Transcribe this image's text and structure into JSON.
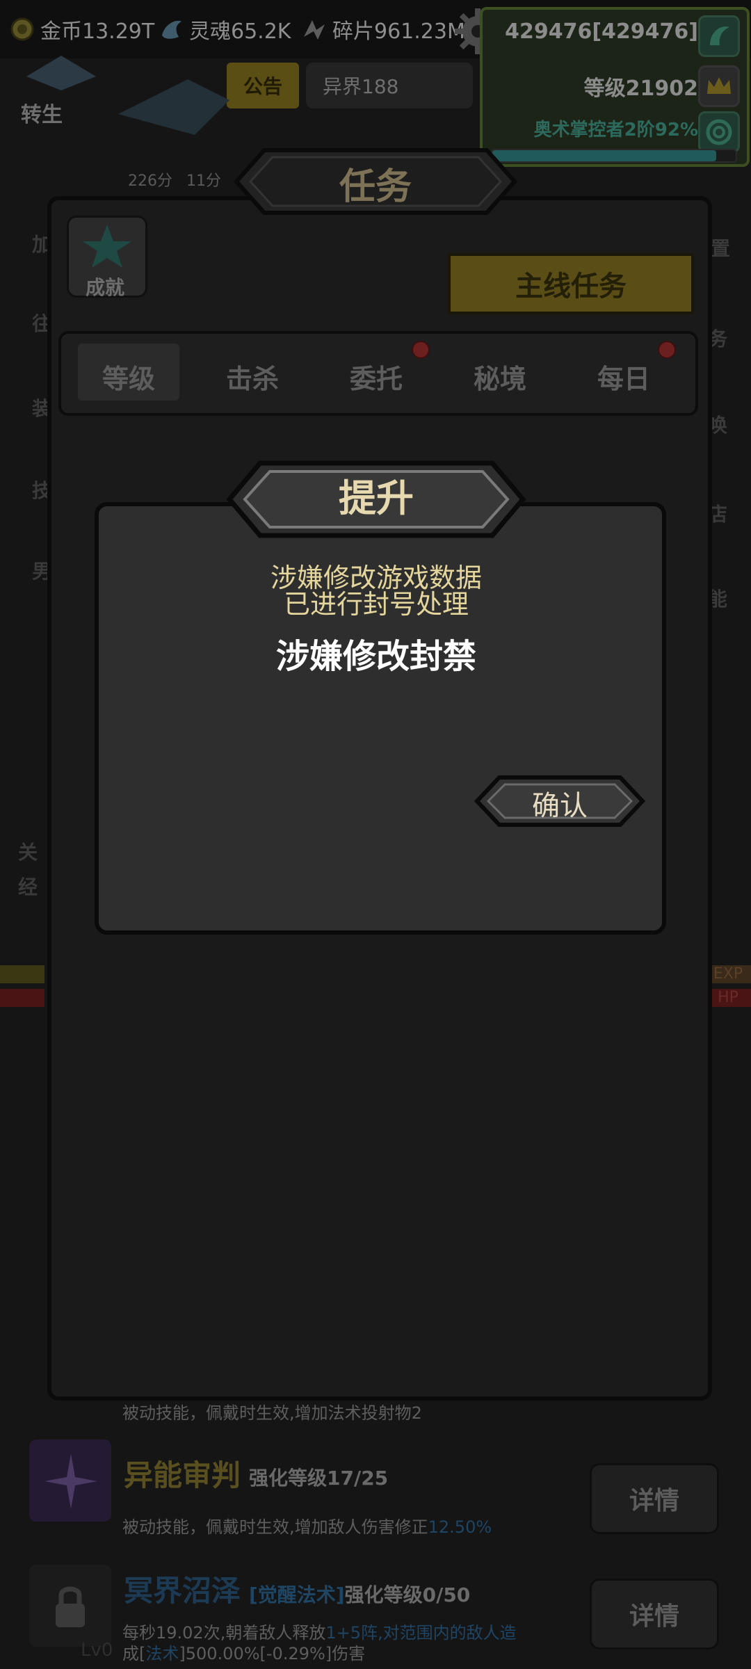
{
  "resources": {
    "gold": "金币13.29T",
    "soul": "灵魂65.2K",
    "fragments": "碎片961.23M"
  },
  "player": {
    "power": "429476[429476]",
    "level": "等级21902",
    "title": "奥术掌控者2阶92%",
    "progress": 0.92
  },
  "header": {
    "notice": "公告",
    "otherworld": "异界188",
    "rebirth": "转生",
    "timer1": "226分",
    "timer2": "11分"
  },
  "dialog": {
    "title": "任务",
    "achievement": "成就",
    "main_quest": "主线任务",
    "tabs": [
      {
        "label": "等级"
      },
      {
        "label": "击杀"
      },
      {
        "label": "委托"
      },
      {
        "label": "秘境"
      },
      {
        "label": "每日"
      }
    ]
  },
  "popup": {
    "title": "提升",
    "message_line1": "涉嫌修改游戏数据",
    "message_line2": "已进行封号处理",
    "reason": "涉嫌修改封禁",
    "confirm": "确认"
  },
  "background_fragments": {
    "left": [
      "加",
      "往",
      "装",
      "技",
      "男",
      "关",
      "经"
    ],
    "right": [
      "置",
      "务",
      "唤",
      "店",
      "能",
      "EXP",
      "HP"
    ]
  },
  "skills": [
    {
      "desc": "被动技能，佩戴时生效,增加法术投射物2"
    },
    {
      "name": "异能审判",
      "level": "强化等级17/25",
      "desc_prefix": "被动技能，佩戴时生效,增加敌人伤害修正",
      "desc_value": "12.50%",
      "detail": "详情"
    },
    {
      "name": "冥界沼泽",
      "tag": "[觉醒法术]",
      "level": "强化等级0/50",
      "desc_line1_a": "每秒19.02次,朝着敌人释放",
      "desc_line1_b": "1+5阵,对范围内的敌人造",
      "desc_line2_a": "成[",
      "desc_line2_b": "法术",
      "desc_line2_c": "]500.00%[-0.29%]伤害",
      "lv": "Lv0",
      "detail": "详情"
    }
  ],
  "colors": {
    "popup_bg": "#2e2e2e",
    "message": "#e5d69d",
    "reason": "#ffffff",
    "title": "#e6d9b0"
  }
}
